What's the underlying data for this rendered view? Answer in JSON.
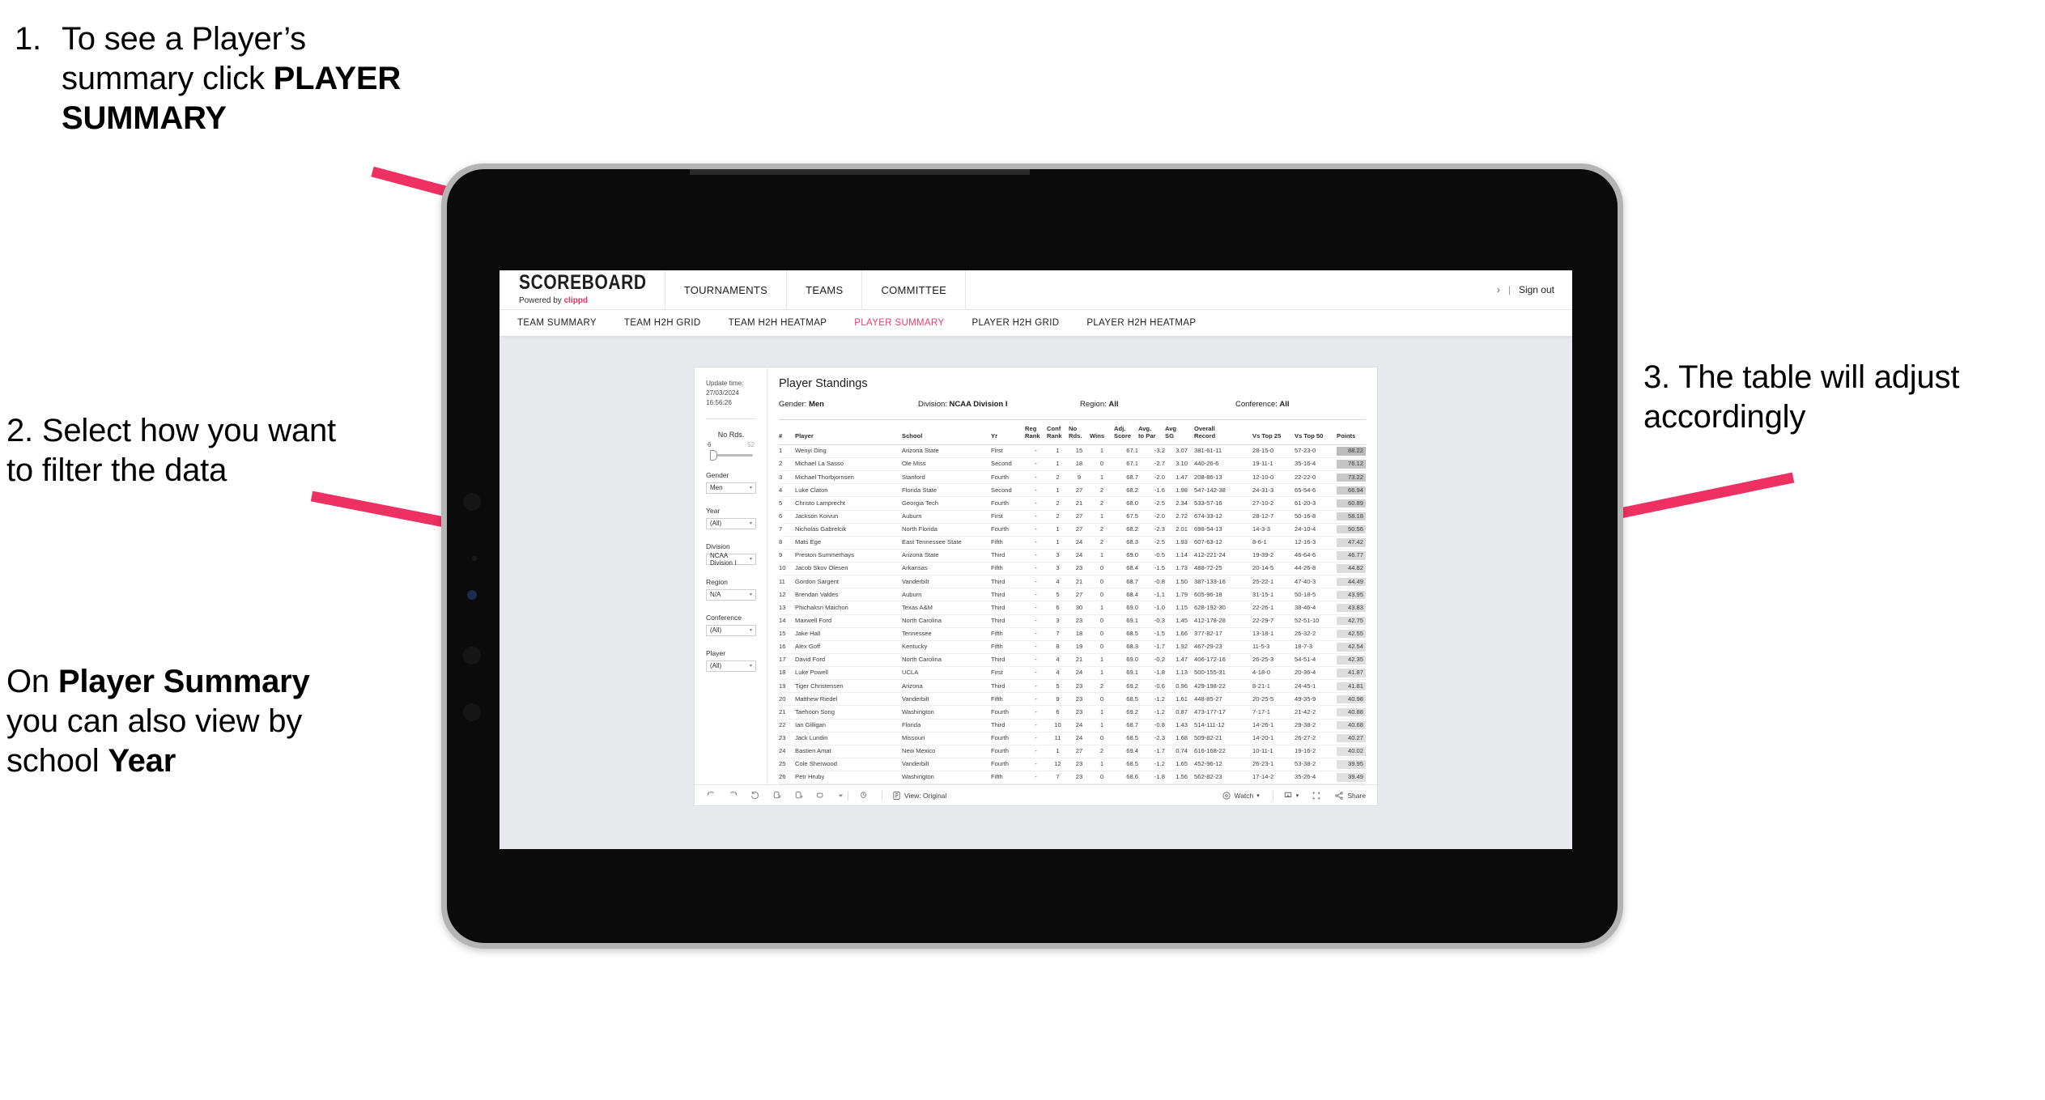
{
  "annotations": {
    "callout1": {
      "number": "1.",
      "text_before": "To see a Player’s summary click ",
      "bold": "PLAYER SUMMARY"
    },
    "callout2": {
      "text": "2. Select how you want to filter the data"
    },
    "callout2b": {
      "part1": "On ",
      "bold1": "Player Summary",
      "part2": " you can also view by school ",
      "bold2": "Year"
    },
    "callout3": {
      "text": "3. The table will adjust accordingly"
    }
  },
  "app": {
    "brand": {
      "logo": "SCOREBOARD",
      "powered_prefix": "Powered by ",
      "powered_brand": "clippd"
    },
    "top_nav": [
      "TOURNAMENTS",
      "TEAMS",
      "COMMITTEE"
    ],
    "header_right": {
      "chevron": "›",
      "separator": "|",
      "sign_out": "Sign out"
    },
    "subnav": {
      "tabs": [
        "TEAM SUMMARY",
        "TEAM H2H GRID",
        "TEAM H2H HEATMAP",
        "PLAYER SUMMARY",
        "PLAYER H2H GRID",
        "PLAYER H2H HEATMAP"
      ],
      "active": "PLAYER SUMMARY",
      "active_color": "#ef3a68"
    }
  },
  "filters": {
    "update_label": "Update time:",
    "update_time": "27/03/2024 16:56:26",
    "slider": {
      "title": "No Rds.",
      "min": "6",
      "max": "52",
      "value_pct": 8
    },
    "groups": [
      {
        "label": "Gender",
        "value": "Men"
      },
      {
        "label": "Year",
        "value": "(All)"
      },
      {
        "label": "Division",
        "value": "NCAA Division I"
      },
      {
        "label": "Region",
        "value": "N/A"
      },
      {
        "label": "Conference",
        "value": "(All)"
      },
      {
        "label": "Player",
        "value": "(All)"
      }
    ],
    "caret": "▾"
  },
  "viz": {
    "title": "Player Standings",
    "meta": [
      {
        "label": "Gender: ",
        "value": "Men"
      },
      {
        "label": "Division: ",
        "value": "NCAA Division I"
      },
      {
        "label": "Region: ",
        "value": "All"
      },
      {
        "label": "Conference: ",
        "value": "All"
      }
    ],
    "toolbar": {
      "icons": [
        "undo-icon",
        "redo-icon",
        "revert-icon",
        "refresh-data-icon",
        "pause-icon",
        "rectangle-select-icon",
        "dropdown-caret-icon"
      ],
      "clock_icon": "history-icon",
      "view_icon": "view-icon",
      "view_label": "View: Original",
      "watch_icon": "watch-icon",
      "watch_label": "Watch",
      "watch_caret": "▾",
      "download_icon": "download-icon",
      "download_caret": "▾",
      "fullscreen_icon": "fullscreen-icon",
      "share_icon": "share-icon",
      "share_label": "Share"
    }
  },
  "chart_data": {
    "type": "table",
    "title": "Player Standings",
    "columns": [
      "#",
      "Player",
      "School",
      "Yr",
      "Reg Rank",
      "Conf Rank",
      "No Rds.",
      "Wins",
      "Adj. Score",
      "Avg. to Par",
      "Avg SG",
      "Overall Record",
      "Vs Top 25",
      "Vs Top 50",
      "Points"
    ],
    "column_headers_wrapped": [
      {
        "line1": "#",
        "line2": ""
      },
      {
        "line1": "Player",
        "line2": ""
      },
      {
        "line1": "School",
        "line2": ""
      },
      {
        "line1": "Yr",
        "line2": ""
      },
      {
        "line1": "Reg",
        "line2": "Rank"
      },
      {
        "line1": "Conf",
        "line2": "Rank"
      },
      {
        "line1": "No",
        "line2": "Rds."
      },
      {
        "line1": "Wins",
        "line2": ""
      },
      {
        "line1": "Adj.",
        "line2": "Score"
      },
      {
        "line1": "Avg.",
        "line2": "to Par"
      },
      {
        "line1": "Avg",
        "line2": "SG"
      },
      {
        "line1": "Overall",
        "line2": "Record"
      },
      {
        "line1": "Vs Top 25",
        "line2": ""
      },
      {
        "line1": "Vs Top 50",
        "line2": ""
      },
      {
        "line1": "Points",
        "line2": ""
      }
    ],
    "rows": [
      [
        "1",
        "Wenyi Ding",
        "Arizona State",
        "First",
        "-",
        "1",
        "15",
        "1",
        "67.1",
        "-3.2",
        "3.07",
        "381-61-11",
        "28-15-0",
        "57-23-0",
        "88.22"
      ],
      [
        "2",
        "Michael La Sasso",
        "Ole Miss",
        "Second",
        "-",
        "1",
        "18",
        "0",
        "67.1",
        "-2.7",
        "3.10",
        "440-26-6",
        "19-11-1",
        "35-16-4",
        "76.12"
      ],
      [
        "3",
        "Michael Thorbjornsen",
        "Stanford",
        "Fourth",
        "-",
        "2",
        "9",
        "1",
        "68.7",
        "-2.0",
        "1.47",
        "208-86-13",
        "12-10-0",
        "22-22-0",
        "73.22"
      ],
      [
        "4",
        "Luke Claton",
        "Florida State",
        "Second",
        "-",
        "1",
        "27",
        "2",
        "68.2",
        "-1.6",
        "1.98",
        "547-142-38",
        "24-31-3",
        "65-54-6",
        "66.94"
      ],
      [
        "5",
        "Christo Lamprecht",
        "Georgia Tech",
        "Fourth",
        "-",
        "2",
        "21",
        "2",
        "68.0",
        "-2.5",
        "2.34",
        "533-57-16",
        "27-10-2",
        "61-20-3",
        "60.89"
      ],
      [
        "6",
        "Jackson Koivun",
        "Auburn",
        "First",
        "-",
        "2",
        "27",
        "1",
        "67.5",
        "-2.0",
        "2.72",
        "674-33-12",
        "28-12-7",
        "50-16-8",
        "58.18"
      ],
      [
        "7",
        "Nicholas Gabrelcik",
        "North Florida",
        "Fourth",
        "-",
        "1",
        "27",
        "2",
        "68.2",
        "-2.3",
        "2.01",
        "698-54-13",
        "14-3-3",
        "24-10-4",
        "50.56"
      ],
      [
        "8",
        "Mats Ege",
        "East Tennessee State",
        "Fifth",
        "-",
        "1",
        "24",
        "2",
        "68.3",
        "-2.5",
        "1.93",
        "607-63-12",
        "8-6-1",
        "12-16-3",
        "47.42"
      ],
      [
        "9",
        "Preston Summerhays",
        "Arizona State",
        "Third",
        "-",
        "3",
        "24",
        "1",
        "69.0",
        "-0.5",
        "1.14",
        "412-221-24",
        "19-39-2",
        "46-64-6",
        "46.77"
      ],
      [
        "10",
        "Jacob Skov Olesen",
        "Arkansas",
        "Fifth",
        "-",
        "3",
        "23",
        "0",
        "68.4",
        "-1.5",
        "1.73",
        "488-72-25",
        "20-14-5",
        "44-26-8",
        "44.82"
      ],
      [
        "11",
        "Gordon Sargent",
        "Vanderbilt",
        "Third",
        "-",
        "4",
        "21",
        "0",
        "68.7",
        "-0.8",
        "1.50",
        "387-133-16",
        "25-22-1",
        "47-40-3",
        "44.49"
      ],
      [
        "12",
        "Brendan Valdes",
        "Auburn",
        "Third",
        "-",
        "5",
        "27",
        "0",
        "68.4",
        "-1.1",
        "1.79",
        "605-96-18",
        "31-15-1",
        "50-18-5",
        "43.95"
      ],
      [
        "13",
        "Phichaksn Maichon",
        "Texas A&M",
        "Third",
        "-",
        "6",
        "30",
        "1",
        "69.0",
        "-1.0",
        "1.15",
        "628-192-30",
        "22-26-1",
        "38-46-4",
        "43.83"
      ],
      [
        "14",
        "Maxwell Ford",
        "North Carolina",
        "Third",
        "-",
        "3",
        "23",
        "0",
        "69.1",
        "-0.3",
        "1.45",
        "412-178-28",
        "22-29-7",
        "52-51-10",
        "42.75"
      ],
      [
        "15",
        "Jake Hall",
        "Tennessee",
        "Fifth",
        "-",
        "7",
        "18",
        "0",
        "68.5",
        "-1.5",
        "1.66",
        "377-82-17",
        "13-18-1",
        "26-32-2",
        "42.55"
      ],
      [
        "16",
        "Alex Goff",
        "Kentucky",
        "Fifth",
        "-",
        "8",
        "19",
        "0",
        "68.3",
        "-1.7",
        "1.92",
        "467-29-23",
        "11-5-3",
        "18-7-3",
        "42.54"
      ],
      [
        "17",
        "David Ford",
        "North Carolina",
        "Third",
        "-",
        "4",
        "21",
        "1",
        "69.0",
        "-0.2",
        "1.47",
        "406-172-16",
        "26-25-3",
        "54-51-4",
        "42.35"
      ],
      [
        "18",
        "Luke Powell",
        "UCLA",
        "First",
        "-",
        "4",
        "24",
        "1",
        "69.1",
        "-1.8",
        "1.13",
        "500-155-31",
        "4-18-0",
        "20-36-4",
        "41.87"
      ],
      [
        "19",
        "Tiger Christensen",
        "Arizona",
        "Third",
        "-",
        "5",
        "23",
        "2",
        "69.2",
        "-0.6",
        "0.96",
        "429-198-22",
        "8-21-1",
        "24-45-1",
        "41.81"
      ],
      [
        "20",
        "Matthew Riedel",
        "Vanderbilt",
        "Fifth",
        "-",
        "9",
        "23",
        "0",
        "68.5",
        "-1.2",
        "1.61",
        "448-85-27",
        "20-25-5",
        "49-35-9",
        "40.98"
      ],
      [
        "21",
        "Taehoon Song",
        "Washington",
        "Fourth",
        "-",
        "6",
        "23",
        "1",
        "69.2",
        "-1.2",
        "0.87",
        "473-177-17",
        "7-17-1",
        "21-42-2",
        "40.88"
      ],
      [
        "22",
        "Ian Gilligan",
        "Florida",
        "Third",
        "-",
        "10",
        "24",
        "1",
        "68.7",
        "-0.8",
        "1.43",
        "514-111-12",
        "14-26-1",
        "29-38-2",
        "40.68"
      ],
      [
        "23",
        "Jack Lundin",
        "Missouri",
        "Fourth",
        "-",
        "11",
        "24",
        "0",
        "68.5",
        "-2.3",
        "1.68",
        "509-82-21",
        "14-20-1",
        "26-27-2",
        "40.27"
      ],
      [
        "24",
        "Bastien Amat",
        "New Mexico",
        "Fourth",
        "-",
        "1",
        "27",
        "2",
        "69.4",
        "-1.7",
        "0.74",
        "616-168-22",
        "10-11-1",
        "19-16-2",
        "40.02"
      ],
      [
        "25",
        "Cole Sherwood",
        "Vanderbilt",
        "Fourth",
        "-",
        "12",
        "23",
        "1",
        "68.5",
        "-1.2",
        "1.65",
        "452-96-12",
        "26-23-1",
        "53-38-2",
        "39.95"
      ],
      [
        "26",
        "Petr Hruby",
        "Washington",
        "Fifth",
        "-",
        "7",
        "23",
        "0",
        "68.6",
        "-1.8",
        "1.56",
        "562-82-23",
        "17-14-2",
        "35-26-4",
        "39.49"
      ]
    ],
    "points_min": 39.49,
    "points_max": 88.22
  },
  "colors": {
    "accent": "#ef3a68",
    "arrow": "#ef3063",
    "tablet_frame": "#b4b4b4",
    "tablet_screen": "#0b0b0b",
    "app_background": "#e7e9ec"
  }
}
